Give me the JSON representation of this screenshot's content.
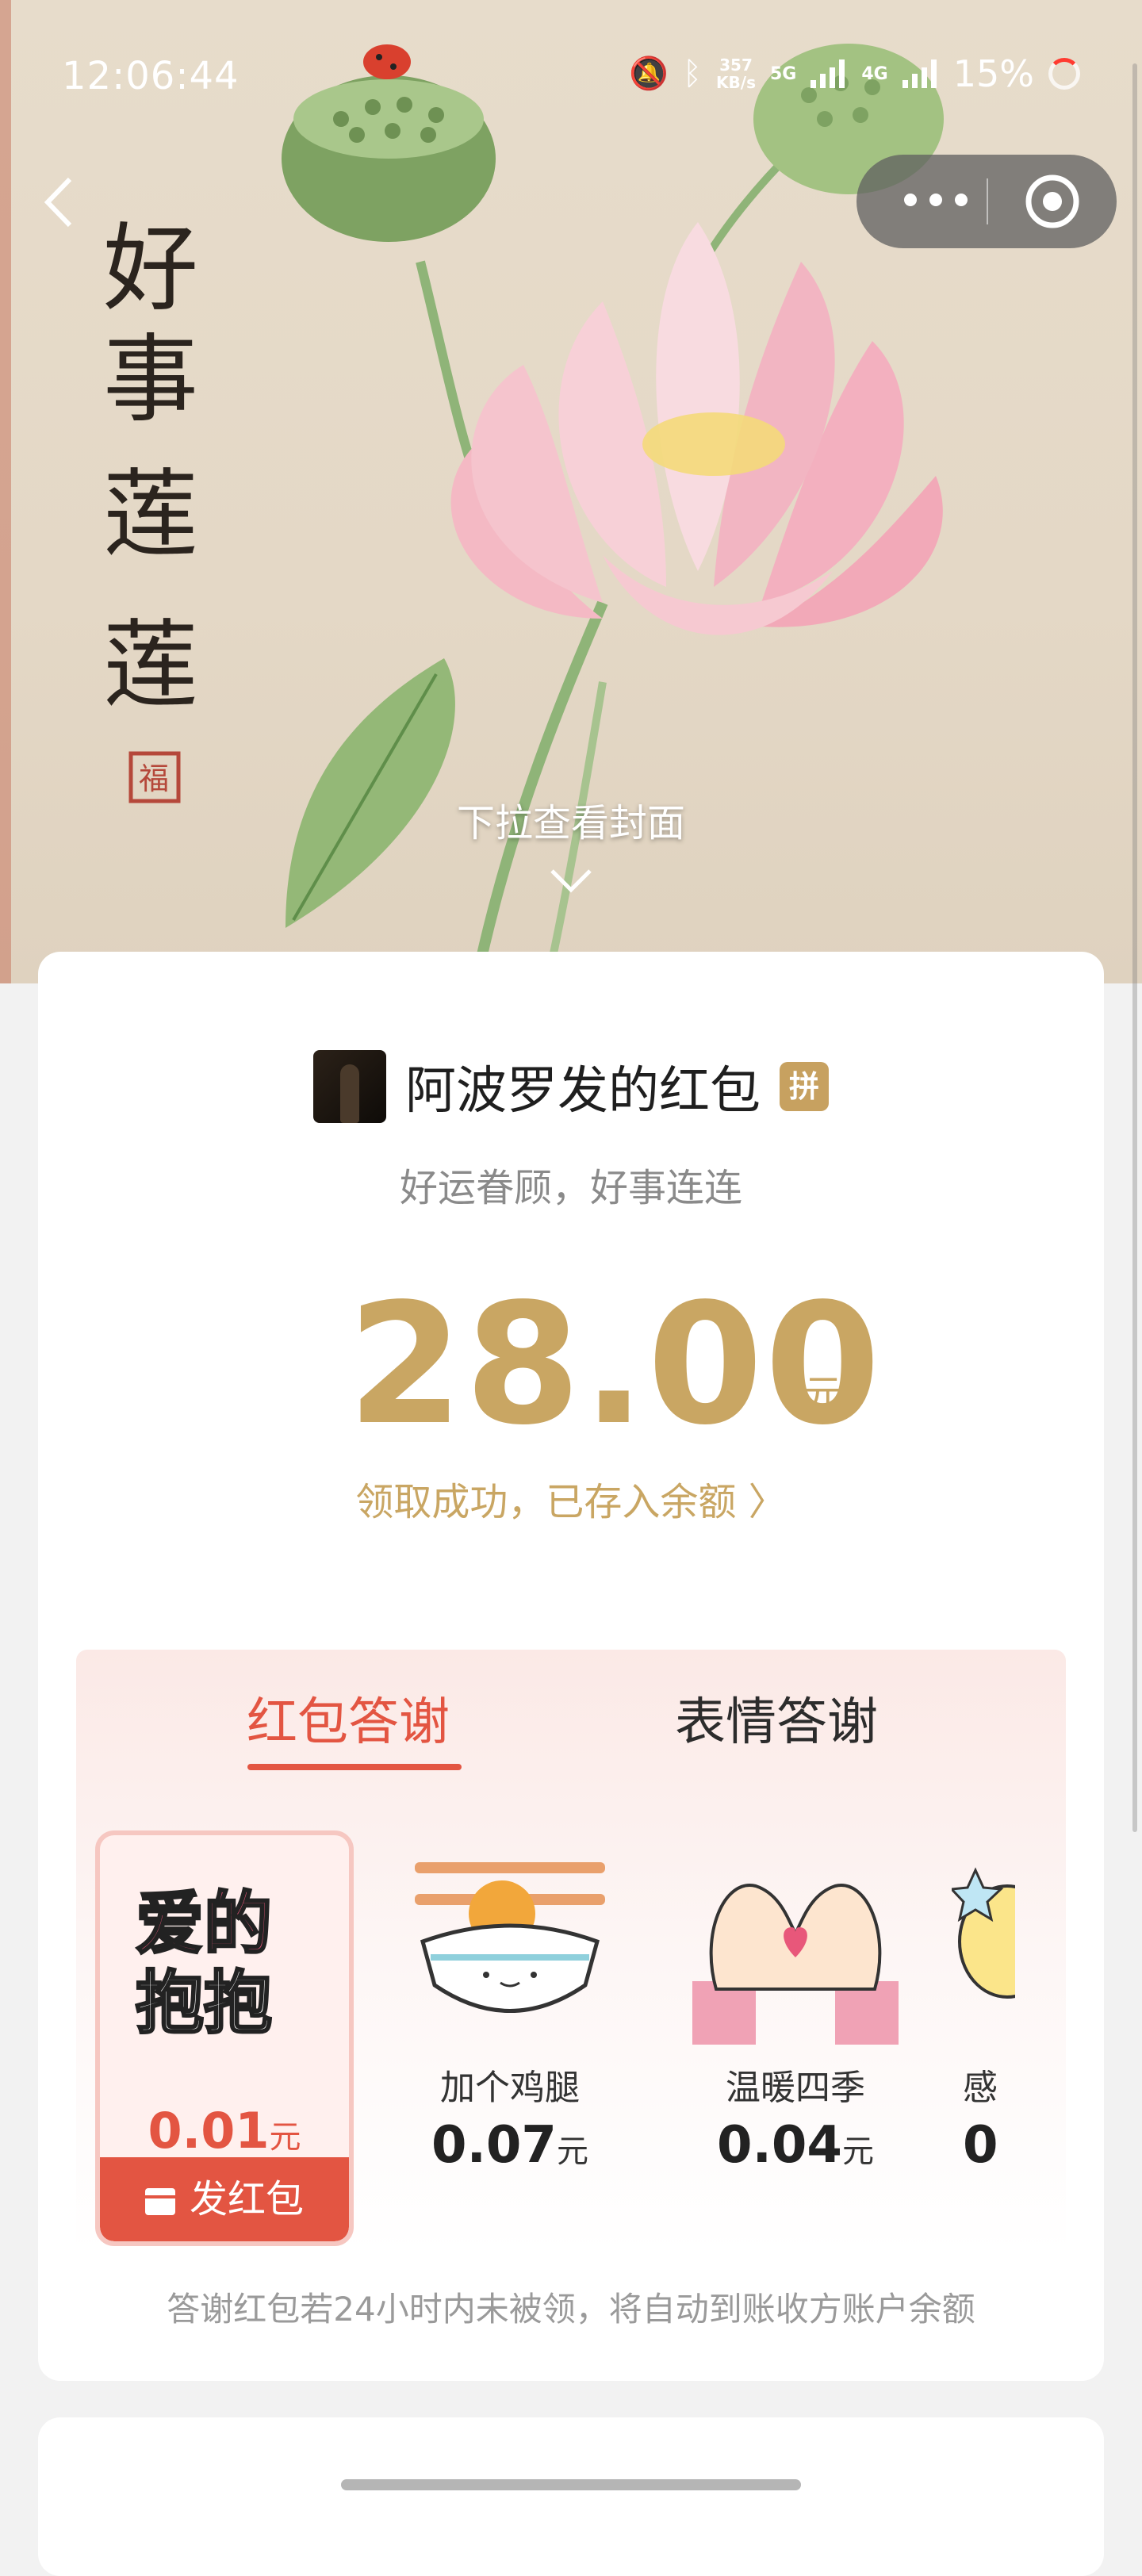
{
  "status_bar": {
    "time": "12:06:44",
    "speed_top": "357",
    "speed_bottom": "KB/s",
    "net1": "5G",
    "net2": "4G",
    "battery": "15%",
    "icons": [
      "mute-bell-icon",
      "bluetooth-icon",
      "signal-icon",
      "signal-icon"
    ]
  },
  "nav": {
    "back_icon": "chevron-left-icon",
    "more_icon": "more-dots-icon",
    "close_icon": "target-circle-icon"
  },
  "cover": {
    "pull_hint": "下拉查看封面",
    "chevron_icon": "chevron-down-icon",
    "art": "lotus-painting with calligraphy, lotus pods, ladybug"
  },
  "packet": {
    "sender": "阿波罗发的红包",
    "badge": "拼",
    "blessing": "好运眷顾，好事连连",
    "amount": "28.00",
    "unit": "元",
    "received_text": "领取成功，已存入余额 〉"
  },
  "thanks": {
    "tabs": [
      {
        "label": "红包答谢",
        "active": true
      },
      {
        "label": "表情答谢",
        "active": false
      }
    ],
    "gifts": [
      {
        "name": "爱的抱抱",
        "price": "0.01",
        "unit": "元",
        "button": "发红包"
      },
      {
        "name": "加个鸡腿",
        "price": "0.07",
        "unit": "元"
      },
      {
        "name": "温暖四季",
        "price": "0.04",
        "unit": "元"
      },
      {
        "name": "感",
        "price": "0",
        "unit": ""
      }
    ],
    "notice": "答谢红包若24小时内未被领，将自动到账收方账户余额"
  },
  "colors": {
    "gold": "#c9a663",
    "red": "#e35542",
    "badge": "#c7a160"
  }
}
